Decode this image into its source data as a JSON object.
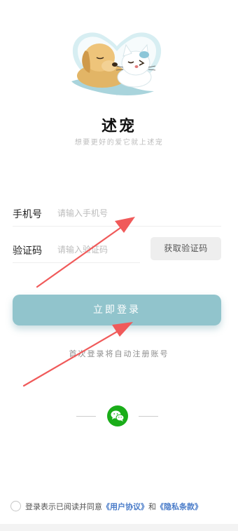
{
  "app": {
    "title": "述宠",
    "slogan": "想要更好的爱它就上述宠"
  },
  "form": {
    "phone_label": "手机号",
    "phone_placeholder": "请输入手机号",
    "code_label": "验证码",
    "code_placeholder": "请输入验证码",
    "get_code_button": "获取验证码",
    "login_button": "立即登录",
    "auto_register_note": "首次登录将自动注册账号"
  },
  "social": {
    "icon": "wechat-icon"
  },
  "agreement": {
    "prefix": "登录表示已阅读并同意",
    "user_agreement": "《用户协议》",
    "conjunction": "和",
    "privacy_policy": "《隐私条款》"
  },
  "colors": {
    "primary_button": "#91c4cc",
    "wechat_green": "#1aad19",
    "link_blue": "#4a7cc9",
    "annotation_red": "#f05a5a"
  }
}
